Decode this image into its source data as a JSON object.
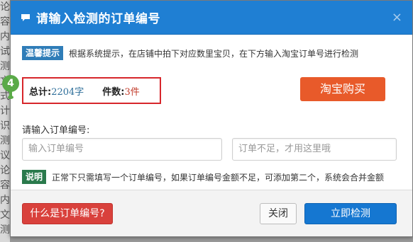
{
  "background": {
    "side_chars": [
      "论",
      "容",
      "内",
      "试",
      "测",
      "文",
      "式",
      "计",
      "识",
      "测",
      "议",
      "论",
      "容",
      "内",
      "文",
      "测"
    ]
  },
  "dialog": {
    "title": "请输入检测的订单编号",
    "close_label": "×"
  },
  "tip": {
    "tag": "温馨提示",
    "text": "根据系统提示，在店铺中拍下对应数里宝贝，在下方输入淘宝订单号进行检测"
  },
  "step": {
    "number": "4"
  },
  "stats": {
    "total_label": "总计:",
    "total_value": "2204字",
    "count_label": "件数:",
    "count_value": "3件"
  },
  "buy_button": "淘宝购买",
  "order": {
    "label": "请输入订单编号:",
    "input_placeholder": "输入订单编号",
    "extra_placeholder": "订单不足，才用这里哦"
  },
  "note": {
    "tag": "说明",
    "text": "正常下只需填写一个订单编号，如果订单编号金额不足，可添加第二个，系统会合并金额"
  },
  "footer": {
    "what_button": "什么是订单编号?",
    "close_button": "关闭",
    "check_button": "立即检测"
  },
  "colors": {
    "header": "#1f7fd3",
    "buy": "#e85a2a",
    "highlight_border": "#d7262b",
    "check": "#1577d1",
    "what": "#d9413c",
    "step": "#5aaa48"
  }
}
